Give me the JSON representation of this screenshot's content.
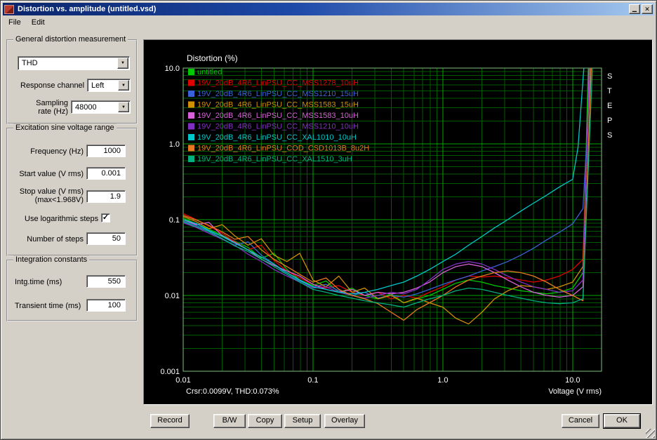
{
  "window": {
    "title": "Distortion vs. amplitude (untitled.vsd)"
  },
  "ui": {
    "arrow_down": "▼",
    "check": "✓",
    "minimize_glyph": "▁",
    "close_glyph": "✕"
  },
  "menu": {
    "file": "File",
    "edit": "Edit"
  },
  "panels": {
    "general": {
      "title": "General distortion measurement",
      "measurement_type": "THD",
      "response_channel_label": "Response channel",
      "response_channel_value": "Left",
      "sampling_rate_label": "Sampling rate (Hz)",
      "sampling_rate_value": "48000"
    },
    "excitation": {
      "title": "Excitation sine voltage range",
      "frequency_label": "Frequency (Hz)",
      "frequency_value": "1000",
      "start_label": "Start value (V rms)",
      "start_value": "0.001",
      "stop_label": "Stop value (V rms)",
      "stop_note": "(max<1.968V)",
      "stop_value": "1.9",
      "log_steps_label": "Use logarithmic steps",
      "log_steps_checked": true,
      "steps_label": "Number of steps",
      "steps_value": "50"
    },
    "integration": {
      "title": "Integration constants",
      "intg_label": "Intg.time (ms)",
      "intg_value": "550",
      "transient_label": "Transient time (ms)",
      "transient_value": "100"
    }
  },
  "buttons": {
    "record": "Record",
    "bw": "B/W",
    "copy": "Copy",
    "setup": "Setup",
    "overlay": "Overlay",
    "cancel": "Cancel",
    "ok": "OK"
  },
  "chart_data": {
    "type": "line",
    "title": "Distortion (%)",
    "xlabel": "Voltage (V rms)",
    "side_label": "STEPS",
    "cursor_readout": "Crsr:0.0099V, THD:0.073%",
    "x_scale": "log",
    "y_scale": "log",
    "xlim": [
      0.01,
      16.7
    ],
    "ylim": [
      0.001,
      10
    ],
    "x_ticks": [
      {
        "v": 0.01,
        "label": "0.01"
      },
      {
        "v": 0.1,
        "label": "0.1"
      },
      {
        "v": 1,
        "label": "1.0"
      },
      {
        "v": 10,
        "label": "10.0"
      }
    ],
    "y_ticks": [
      {
        "v": 10,
        "label": "10.0"
      },
      {
        "v": 1,
        "label": "1.0"
      },
      {
        "v": 0.1,
        "label": "0.1"
      },
      {
        "v": 0.01,
        "label": "0.01"
      },
      {
        "v": 0.001,
        "label": "0.001"
      }
    ],
    "grid": {
      "major_color": "#00a800",
      "minor_color": "#005c00",
      "frame_color": "#7fbf7f",
      "background": "#000000",
      "text_color": "#ffffff"
    },
    "legend_position": "top-left",
    "x": [
      0.01,
      0.0126,
      0.0158,
      0.02,
      0.025,
      0.0316,
      0.04,
      0.05,
      0.063,
      0.079,
      0.1,
      0.126,
      0.158,
      0.2,
      0.25,
      0.316,
      0.4,
      0.5,
      0.63,
      0.79,
      1.0,
      1.26,
      1.58,
      2.0,
      2.5,
      3.16,
      4.0,
      5.0,
      6.3,
      7.9,
      10.0
    ],
    "series": [
      {
        "name": "untitled",
        "color": "#00c800",
        "y": [
          0.105,
          0.088,
          0.075,
          0.062,
          0.052,
          0.043,
          0.031,
          0.036,
          0.022,
          0.016,
          0.0135,
          0.0155,
          0.011,
          0.0125,
          0.01,
          0.009,
          0.0105,
          0.008,
          0.009,
          0.01,
          0.012,
          0.0145,
          0.016,
          0.015,
          0.0135,
          0.0125,
          0.0115,
          0.011,
          0.0105,
          0.011,
          0.0125
        ],
        "tail": [
          [
            12,
            0.02
          ],
          [
            13.2,
            10
          ]
        ]
      },
      {
        "name": "19V_20dB_4R6_LinPSU_CC_MSS1278_10uH",
        "color": "#e00000",
        "y": [
          0.12,
          0.1,
          0.082,
          0.066,
          0.051,
          0.04,
          0.046,
          0.029,
          0.021,
          0.017,
          0.014,
          0.0125,
          0.0135,
          0.011,
          0.01,
          0.011,
          0.009,
          0.01,
          0.0092,
          0.011,
          0.013,
          0.016,
          0.018,
          0.0175,
          0.018,
          0.017,
          0.016,
          0.015,
          0.016,
          0.018,
          0.022
        ],
        "tail": [
          [
            12,
            0.03
          ],
          [
            13.5,
            10
          ]
        ]
      },
      {
        "name": "19V_20dB_4R6_LinPSU_CC_MSS1210_15uH",
        "color": "#3a62d8",
        "y": [
          0.096,
          0.084,
          0.071,
          0.056,
          0.046,
          0.051,
          0.034,
          0.026,
          0.019,
          0.0155,
          0.013,
          0.014,
          0.0115,
          0.01,
          0.011,
          0.0092,
          0.01,
          0.0095,
          0.0105,
          0.012,
          0.014,
          0.016,
          0.018,
          0.021,
          0.024,
          0.028,
          0.034,
          0.042,
          0.054,
          0.068,
          0.088
        ],
        "tail": [
          [
            12,
            0.14
          ],
          [
            13.8,
            10
          ]
        ]
      },
      {
        "name": "19V_20dB_4R6_LinPSU_CC_MSS1583_15uH",
        "color": "#d09000",
        "y": [
          0.11,
          0.094,
          0.076,
          0.086,
          0.061,
          0.046,
          0.056,
          0.034,
          0.028,
          0.036,
          0.016,
          0.013,
          0.018,
          0.011,
          0.0125,
          0.009,
          0.01,
          0.008,
          0.0092,
          0.008,
          0.007,
          0.005,
          0.0042,
          0.006,
          0.009,
          0.0115,
          0.0135,
          0.013,
          0.012,
          0.013,
          0.015
        ],
        "tail": [
          [
            12,
            0.024
          ],
          [
            13.6,
            10
          ]
        ]
      },
      {
        "name": "19V_20dB_4R6_LinPSU_CC_MSS1583_10uH",
        "color": "#d860d8",
        "y": [
          0.1,
          0.086,
          0.092,
          0.061,
          0.05,
          0.04,
          0.03,
          0.025,
          0.021,
          0.018,
          0.014,
          0.012,
          0.011,
          0.012,
          0.01,
          0.011,
          0.0105,
          0.011,
          0.0125,
          0.015,
          0.02,
          0.024,
          0.026,
          0.024,
          0.02,
          0.016,
          0.013,
          0.011,
          0.01,
          0.0095,
          0.01
        ],
        "tail": [
          [
            12,
            0.013
          ],
          [
            13.4,
            10
          ]
        ]
      },
      {
        "name": "19V_20dB_4R6_LinPSU_CC_MSS1210_10uH",
        "color": "#8030c0",
        "y": [
          0.091,
          0.079,
          0.066,
          0.055,
          0.046,
          0.035,
          0.028,
          0.022,
          0.018,
          0.015,
          0.0125,
          0.013,
          0.011,
          0.01,
          0.0092,
          0.01,
          0.011,
          0.0105,
          0.012,
          0.016,
          0.022,
          0.026,
          0.028,
          0.026,
          0.022,
          0.018,
          0.015,
          0.013,
          0.012,
          0.011,
          0.0115
        ],
        "tail": [
          [
            12,
            0.016
          ],
          [
            13.5,
            10
          ]
        ]
      },
      {
        "name": "19V_20dB_4R6_LinPSU_CC_XAL1010_10uH",
        "color": "#00c8c8",
        "y": [
          0.1,
          0.089,
          0.072,
          0.06,
          0.049,
          0.04,
          0.032,
          0.026,
          0.02,
          0.016,
          0.013,
          0.012,
          0.011,
          0.0105,
          0.011,
          0.012,
          0.0135,
          0.015,
          0.018,
          0.022,
          0.028,
          0.035,
          0.046,
          0.06,
          0.078,
          0.1,
          0.13,
          0.165,
          0.21,
          0.27,
          0.34
        ],
        "tail": [
          [
            11,
            0.9
          ],
          [
            12.2,
            10
          ]
        ]
      },
      {
        "name": "19V_20dB_4R6_LinPSU_COD_CSD1013B_8u2H",
        "color": "#e87820",
        "y": [
          0.114,
          0.099,
          0.084,
          0.069,
          0.055,
          0.06,
          0.04,
          0.03,
          0.024,
          0.019,
          0.015,
          0.017,
          0.012,
          0.01,
          0.009,
          0.0078,
          0.006,
          0.0047,
          0.0065,
          0.008,
          0.01,
          0.013,
          0.016,
          0.018,
          0.02,
          0.021,
          0.02,
          0.018,
          0.015,
          0.012,
          0.01
        ],
        "tail": [
          [
            12,
            0.0085
          ],
          [
            13.9,
            10
          ]
        ]
      },
      {
        "name": "19V_20dB_4R6_LinPSU_CC_XAL1510_3uH",
        "color": "#00b080",
        "y": [
          0.094,
          0.081,
          0.069,
          0.056,
          0.045,
          0.038,
          0.03,
          0.024,
          0.019,
          0.015,
          0.012,
          0.011,
          0.01,
          0.0092,
          0.0085,
          0.008,
          0.0075,
          0.007,
          0.008,
          0.009,
          0.01,
          0.0115,
          0.0125,
          0.012,
          0.011,
          0.01,
          0.0092,
          0.0085,
          0.008,
          0.0078,
          0.008
        ],
        "tail": [
          [
            12,
            0.009
          ],
          [
            14.2,
            10
          ]
        ]
      }
    ]
  }
}
